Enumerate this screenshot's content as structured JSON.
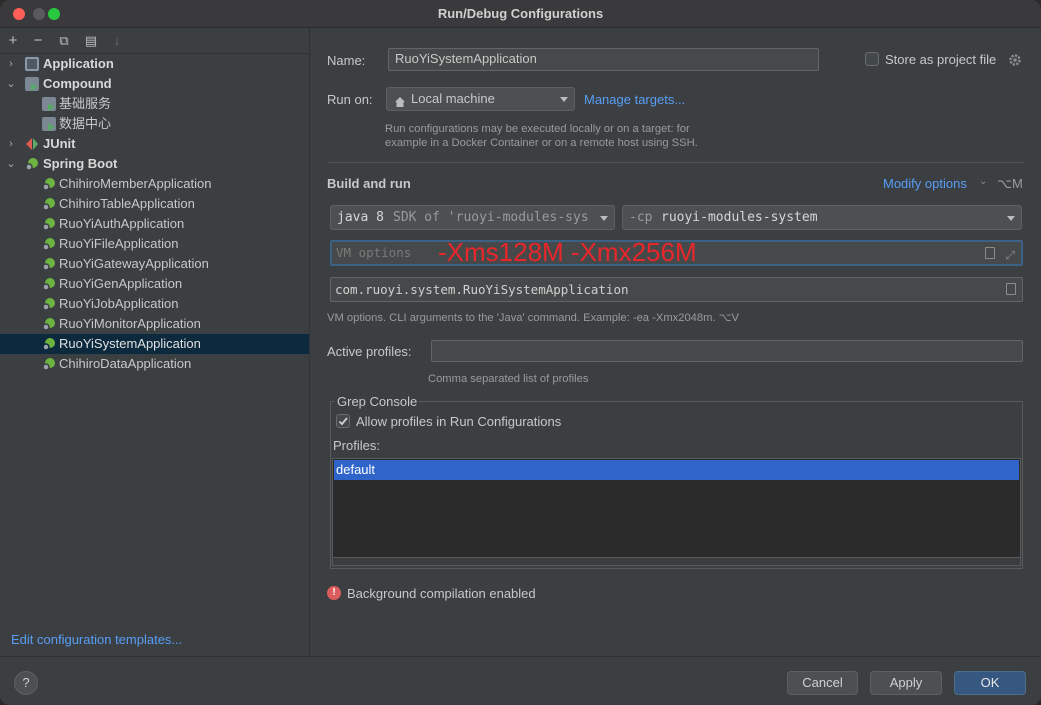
{
  "window": {
    "title": "Run/Debug Configurations"
  },
  "sidebar": {
    "toolbar": {
      "add": "+",
      "remove": "−",
      "copy": "⧉",
      "folder": "▤",
      "sort": "↓"
    },
    "tree": [
      {
        "label": "Application",
        "type": "group",
        "expanded": false,
        "icon": "application-icon"
      },
      {
        "label": "Compound",
        "type": "group",
        "expanded": true,
        "icon": "compound-icon"
      },
      {
        "label": "基础服务",
        "type": "item",
        "icon": "compound-icon"
      },
      {
        "label": "数据中心",
        "type": "item",
        "icon": "compound-icon"
      },
      {
        "label": "JUnit",
        "type": "group",
        "expanded": false,
        "icon": "junit-icon"
      },
      {
        "label": "Spring Boot",
        "type": "group",
        "expanded": true,
        "icon": "spring-boot-icon"
      },
      {
        "label": "ChihiroMemberApplication",
        "type": "item",
        "icon": "spring-boot-icon"
      },
      {
        "label": "ChihiroTableApplication",
        "type": "item",
        "icon": "spring-boot-icon"
      },
      {
        "label": "RuoYiAuthApplication",
        "type": "item",
        "icon": "spring-boot-icon"
      },
      {
        "label": "RuoYiFileApplication",
        "type": "item",
        "icon": "spring-boot-icon"
      },
      {
        "label": "RuoYiGatewayApplication",
        "type": "item",
        "icon": "spring-boot-icon"
      },
      {
        "label": "RuoYiGenApplication",
        "type": "item",
        "icon": "spring-boot-icon"
      },
      {
        "label": "RuoYiJobApplication",
        "type": "item",
        "icon": "spring-boot-icon"
      },
      {
        "label": "RuoYiMonitorApplication",
        "type": "item",
        "icon": "spring-boot-icon"
      },
      {
        "label": "RuoYiSystemApplication",
        "type": "item",
        "icon": "spring-boot-icon",
        "selected": true
      },
      {
        "label": "ChihiroDataApplication",
        "type": "item",
        "icon": "spring-boot-icon"
      }
    ],
    "edit_templates": "Edit configuration templates..."
  },
  "config": {
    "name_label": "Name:",
    "name_value": "RuoYiSystemApplication",
    "store_label": "Store as project file",
    "run_on_label": "Run on:",
    "run_on_value": "Local machine",
    "manage_targets": "Manage targets...",
    "run_on_hint_1": "Run configurations may be executed locally or on a target: for",
    "run_on_hint_2": "example in a Docker Container or on a remote host using SSH.",
    "build_run_title": "Build and run",
    "modify_options": "Modify options",
    "modify_shortcut": "⌥M",
    "jdk_main": "java 8",
    "jdk_detail": "SDK of 'ruoyi-modules-sys",
    "cp_prefix": "-cp",
    "cp_value": "ruoyi-modules-system",
    "vm_placeholder": "VM options",
    "vm_annotation": "-Xms128M -Xmx256M",
    "main_class": "com.ruoyi.system.RuoYiSystemApplication",
    "vm_hint": "VM options. CLI arguments to the 'Java' command. Example: -ea -Xmx2048m. ⌥V",
    "active_profiles_label": "Active profiles:",
    "active_profiles_value": "",
    "profiles_hint": "Comma separated list of profiles",
    "grep_title": "Grep Console",
    "allow_profiles_label": "Allow profiles in Run Configurations",
    "profiles_label": "Profiles:",
    "profiles_list": [
      "default"
    ],
    "warning": "Background compilation enabled"
  },
  "footer": {
    "help": "?",
    "cancel": "Cancel",
    "apply": "Apply",
    "ok": "OK"
  },
  "colors": {
    "accent_link": "#589df6",
    "selection": "#2f65ca",
    "annotation_red": "#e8262b"
  }
}
